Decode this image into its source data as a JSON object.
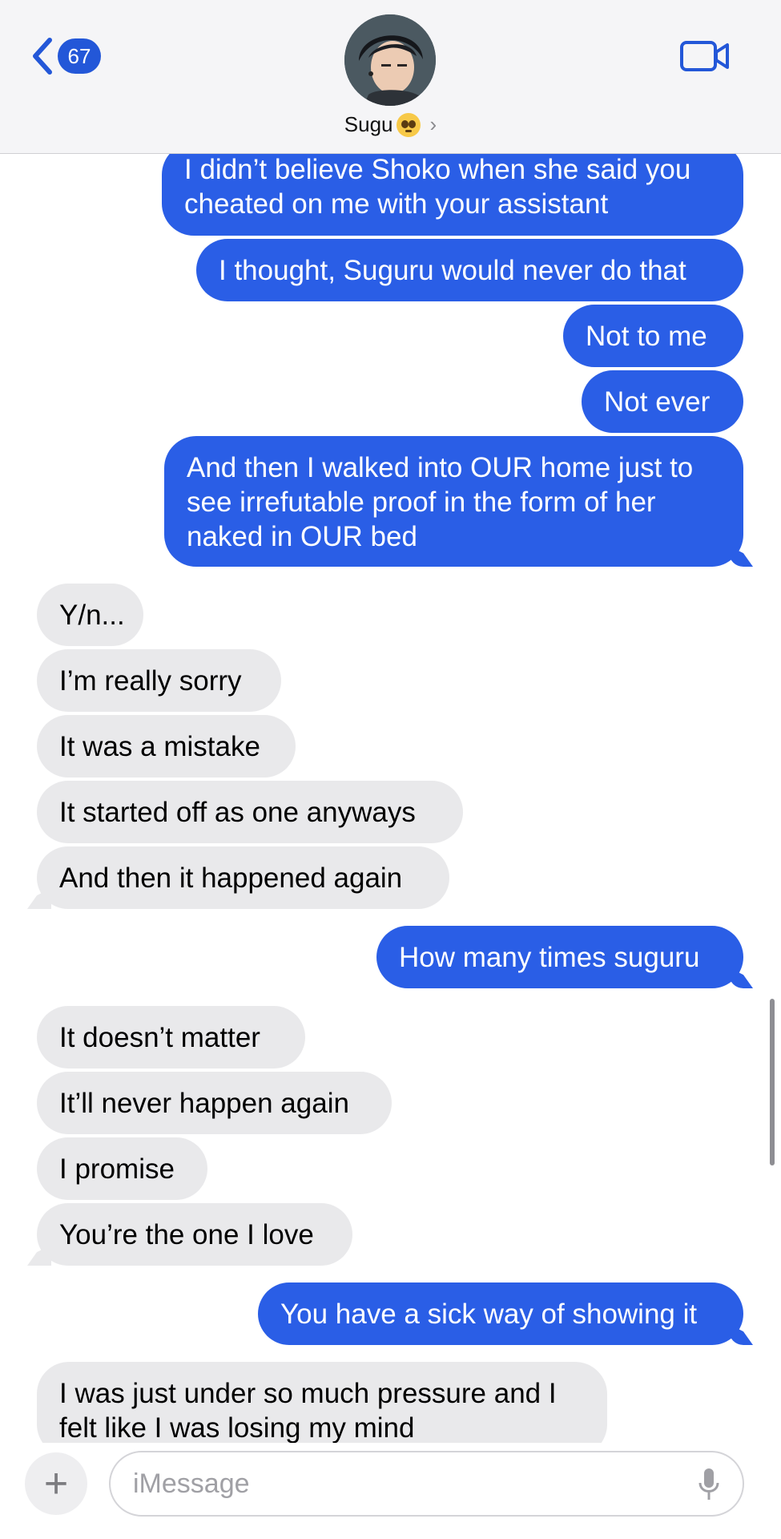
{
  "header": {
    "unread_count": "67",
    "contact_name": "Sugu",
    "contact_emoji": "pleading-face",
    "icons": [
      "back-chevron-icon",
      "chevron-right-icon",
      "video-camera-icon"
    ],
    "accent_color": "#2357d8"
  },
  "messages": [
    {
      "from": "me",
      "text": "I didn’t believe Shoko when she said you cheated on me with your assistant"
    },
    {
      "from": "me",
      "text": "I thought, Suguru would never do that"
    },
    {
      "from": "me",
      "text": "Not to me"
    },
    {
      "from": "me",
      "text": "Not ever"
    },
    {
      "from": "me",
      "text": "And then I walked into OUR home just to see irrefutable proof in the form of her naked in OUR bed"
    },
    {
      "from": "them",
      "text": "Y/n..."
    },
    {
      "from": "them",
      "text": "I’m really sorry"
    },
    {
      "from": "them",
      "text": "It was a mistake"
    },
    {
      "from": "them",
      "text": "It started off as one anyways"
    },
    {
      "from": "them",
      "text": "And then it happened again"
    },
    {
      "from": "me",
      "text": "How many times suguru"
    },
    {
      "from": "them",
      "text": "It doesn’t matter"
    },
    {
      "from": "them",
      "text": "It’ll never happen again"
    },
    {
      "from": "them",
      "text": "I promise"
    },
    {
      "from": "them",
      "text": "You’re the one I love"
    },
    {
      "from": "me",
      "text": "You have a sick way of showing it"
    },
    {
      "from": "them",
      "text": "I was just under so much pressure and I felt like I was losing my mind"
    }
  ],
  "composer": {
    "placeholder": "iMessage",
    "icons": [
      "plus-icon",
      "microphone-icon"
    ]
  },
  "colors": {
    "sent_bubble": "#2a5ee6",
    "received_bubble": "#e9e9eb",
    "header_bg": "#f5f5f7"
  }
}
